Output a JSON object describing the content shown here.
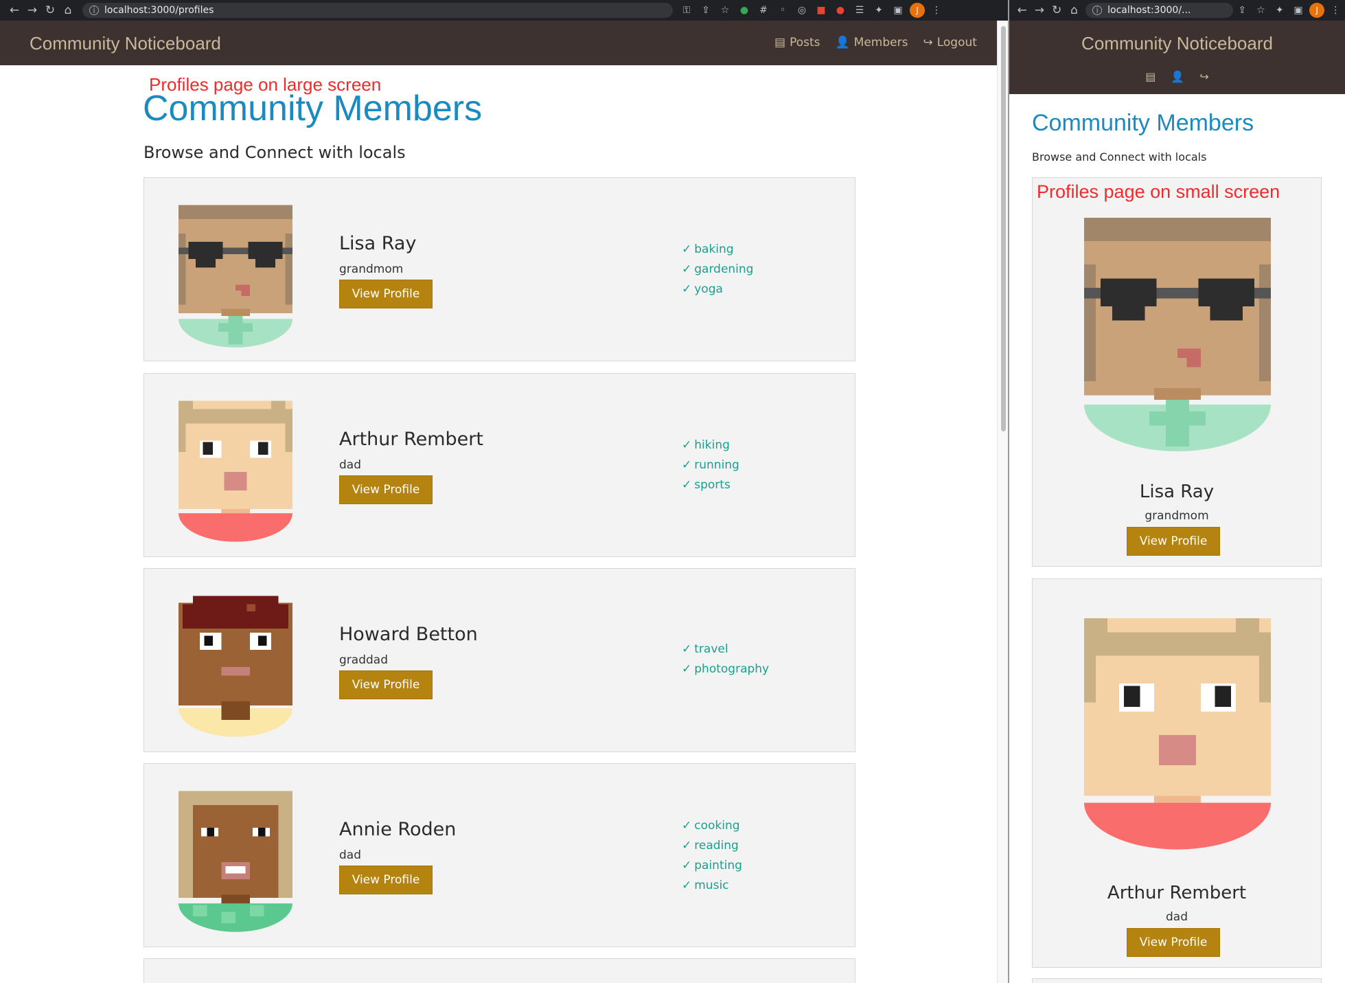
{
  "left_window": {
    "url": "localhost:3000/profiles",
    "brand": "Community Noticeboard",
    "nav": [
      "Posts",
      "Members",
      "Logout"
    ],
    "annotation": "Profiles page on large screen",
    "heading": "Community Members",
    "subheading": "Browse and Connect with locals",
    "button_label": "View Profile",
    "members": [
      {
        "name": "Lisa Ray",
        "role": "grandmom",
        "interests": [
          "baking",
          "gardening",
          "yoga"
        ]
      },
      {
        "name": "Arthur Rembert",
        "role": "dad",
        "interests": [
          "hiking",
          "running",
          "sports"
        ]
      },
      {
        "name": "Howard Betton",
        "role": "graddad",
        "interests": [
          "travel",
          "photography"
        ]
      },
      {
        "name": "Annie Roden",
        "role": "dad",
        "interests": [
          "cooking",
          "reading",
          "painting",
          "music"
        ]
      }
    ]
  },
  "right_window": {
    "url": "localhost:3000/...",
    "brand": "Community Noticeboard",
    "annotation": "Profiles page on small screen",
    "heading": "Community Members",
    "subheading": "Browse and Connect with locals",
    "button_label": "View Profile",
    "members": [
      {
        "name": "Lisa Ray",
        "role": "grandmom"
      },
      {
        "name": "Arthur Rembert",
        "role": "dad"
      }
    ]
  },
  "profile_initial": "J",
  "colors": {
    "nav_bg": "#3d3230",
    "brand": "#c9b99a",
    "heading": "#1a8ac0",
    "button": "#b5830f",
    "check": "#18a08e",
    "annotation": "#ef2b2b"
  },
  "icons": [
    "back-icon",
    "forward-icon",
    "reload-icon",
    "home-icon",
    "key-icon",
    "share-icon",
    "star-icon",
    "puzzle-icon",
    "sidebar-icon",
    "menu-icon",
    "file-icon",
    "user-icon",
    "logout-icon",
    "check-icon"
  ]
}
